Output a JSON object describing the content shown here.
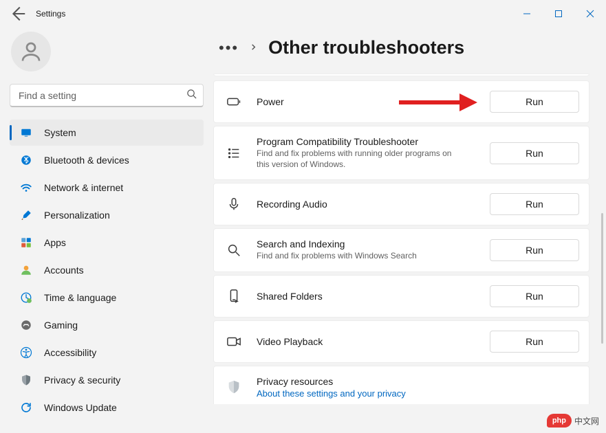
{
  "window": {
    "title": "Settings"
  },
  "search": {
    "placeholder": "Find a setting"
  },
  "sidebar": {
    "items": [
      {
        "id": "system",
        "label": "System",
        "active": true
      },
      {
        "id": "bluetooth",
        "label": "Bluetooth & devices"
      },
      {
        "id": "network",
        "label": "Network & internet"
      },
      {
        "id": "personalization",
        "label": "Personalization"
      },
      {
        "id": "apps",
        "label": "Apps"
      },
      {
        "id": "accounts",
        "label": "Accounts"
      },
      {
        "id": "time",
        "label": "Time & language"
      },
      {
        "id": "gaming",
        "label": "Gaming"
      },
      {
        "id": "accessibility",
        "label": "Accessibility"
      },
      {
        "id": "privacy",
        "label": "Privacy & security"
      },
      {
        "id": "update",
        "label": "Windows Update"
      }
    ]
  },
  "header": {
    "page_title": "Other troubleshooters"
  },
  "buttons": {
    "run": "Run"
  },
  "cards": {
    "power": {
      "title": "Power"
    },
    "compat": {
      "title": "Program Compatibility Troubleshooter",
      "sub": "Find and fix problems with running older programs on this version of Windows."
    },
    "recording": {
      "title": "Recording Audio"
    },
    "search": {
      "title": "Search and Indexing",
      "sub": "Find and fix problems with Windows Search"
    },
    "shared": {
      "title": "Shared Folders"
    },
    "video": {
      "title": "Video Playback"
    },
    "privacy": {
      "title": "Privacy resources",
      "link": "About these settings and your privacy"
    }
  },
  "watermark": {
    "bubble": "php",
    "cn": "中文网"
  }
}
